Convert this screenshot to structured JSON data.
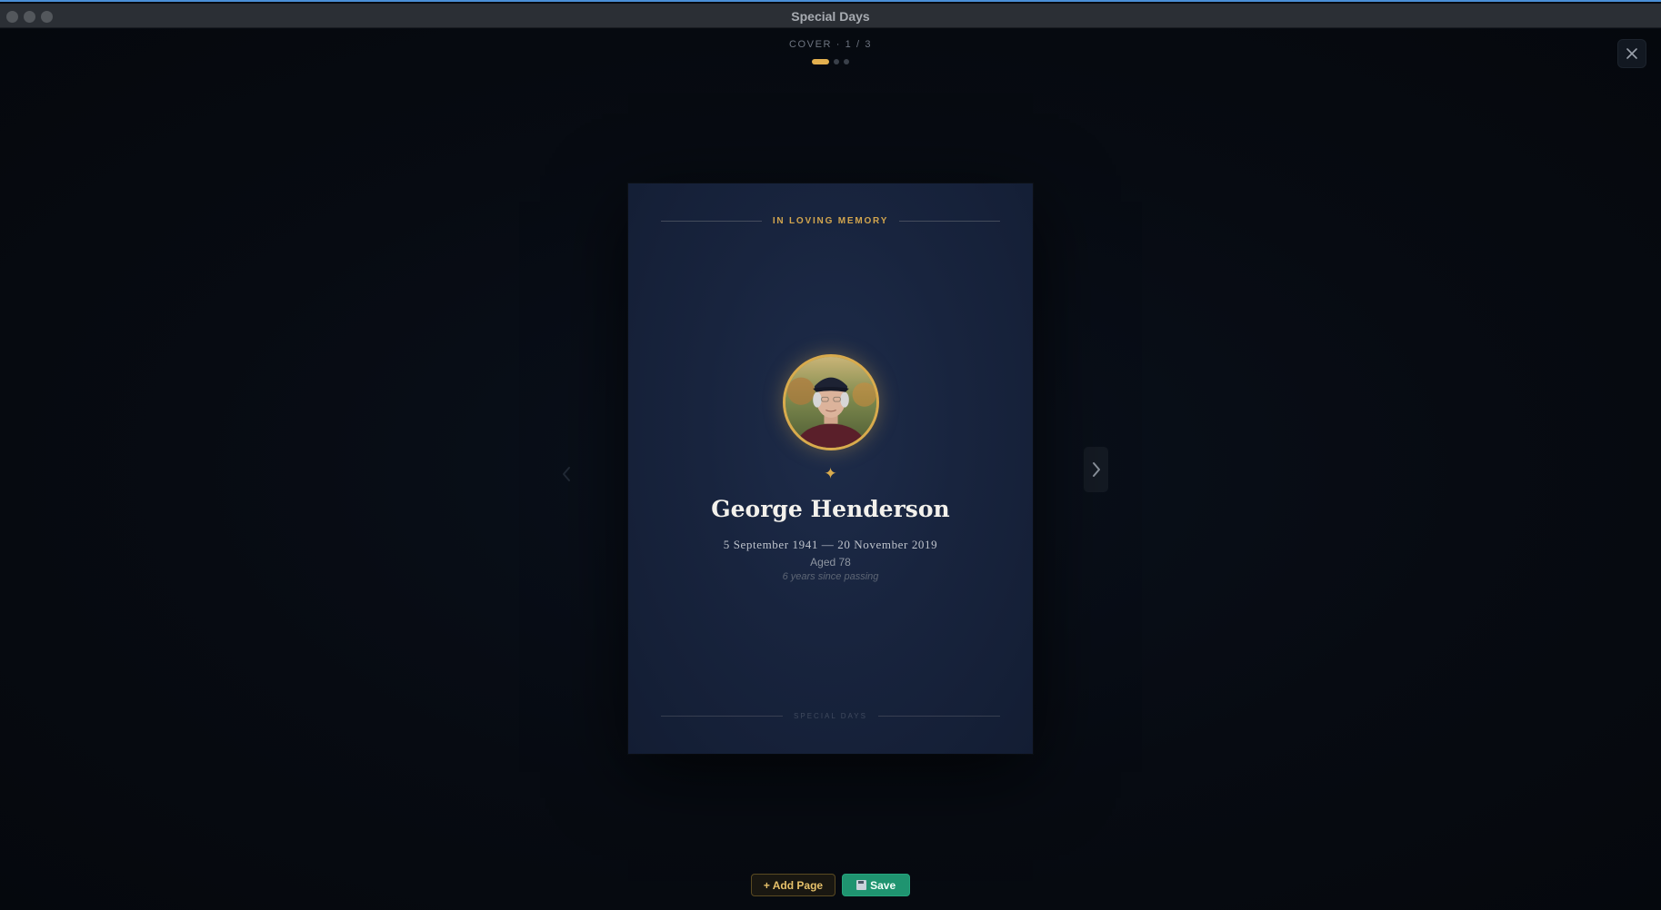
{
  "window": {
    "title": "Special Days"
  },
  "header": {
    "page_indicator": "COVER · 1 / 3",
    "dots": [
      {
        "active": true
      },
      {
        "active": false
      },
      {
        "active": false
      }
    ]
  },
  "icons": {
    "close": "close-icon",
    "prev": "chevron-left-icon",
    "next": "chevron-right-icon",
    "star": "four-point-star-icon",
    "save": "floppy-disk-icon"
  },
  "card": {
    "top_label": "IN LOVING MEMORY",
    "star_glyph": "✦",
    "name": "George Henderson",
    "dates": "5 September 1941 — 20 November 2019",
    "aged": "Aged 78",
    "since": "6 years since passing",
    "bottom_label": "SPECIAL DAYS"
  },
  "toolbar": {
    "add_label": "+ Add Page",
    "save_label": "Save"
  },
  "colors": {
    "accent_gold": "#d9ab4d",
    "save_green": "#1f9470",
    "card_navy": "#18243e",
    "background": "#070b12"
  }
}
